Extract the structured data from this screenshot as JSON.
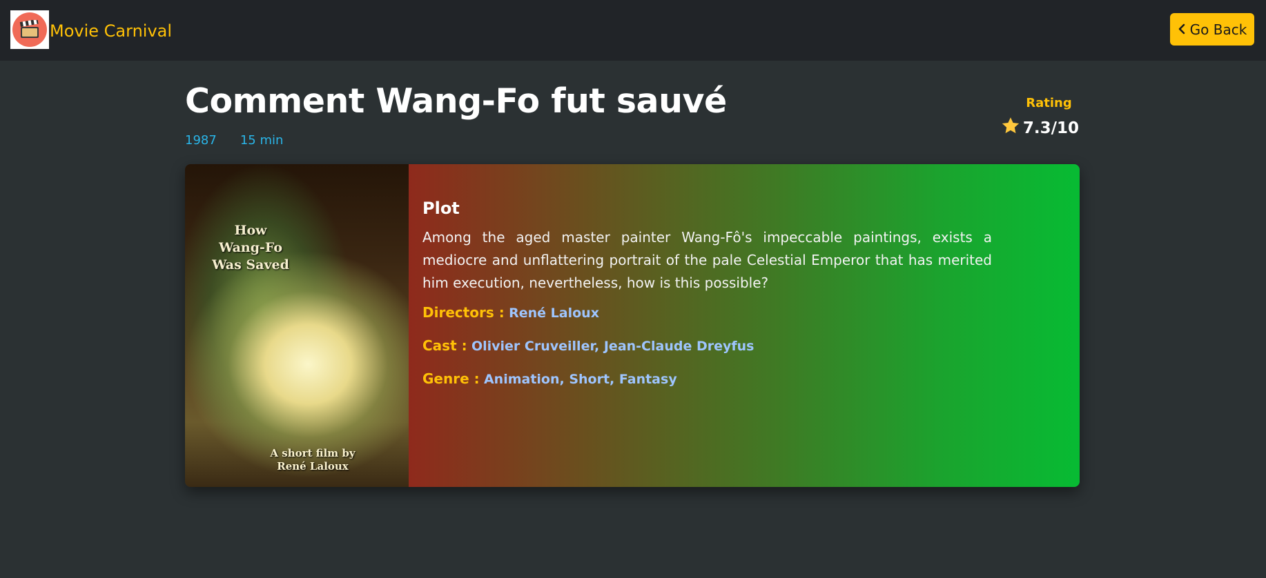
{
  "navbar": {
    "brand": "Movie Carnival",
    "back_button": "Go Back"
  },
  "movie": {
    "title": "Comment Wang-Fo fut sauvé",
    "year": "1987",
    "runtime": "15 min",
    "rating_label": "Rating",
    "rating_value": "7.3/10",
    "poster": {
      "title_line1": "How",
      "title_line2": "Wang-Fo",
      "title_line3": "Was Saved",
      "credit_line1": "A short film by",
      "credit_line2": "René Laloux"
    },
    "plot_heading": "Plot",
    "plot": "Among the aged master painter Wang-Fô's impeccable paintings, exists a mediocre and unflattering portrait of the pale Celestial Emperor that has merited him execution, nevertheless, how is this possible?",
    "directors_label": "Directors :",
    "directors": "René Laloux",
    "cast_label": "Cast :",
    "cast": "Olivier Cruveiller, Jean-Claude Dreyfus",
    "genre_label": "Genre :",
    "genre": "Animation, Short, Fantasy"
  },
  "colors": {
    "accent": "#ffc107",
    "navbar_bg": "#212428",
    "page_bg": "#2b3133",
    "meta_text": "#2ab5e8",
    "link_text": "#9ec5fe"
  },
  "icons": {
    "logo": "clapperboard-icon",
    "back": "chevron-left-icon",
    "rating": "star-icon"
  }
}
